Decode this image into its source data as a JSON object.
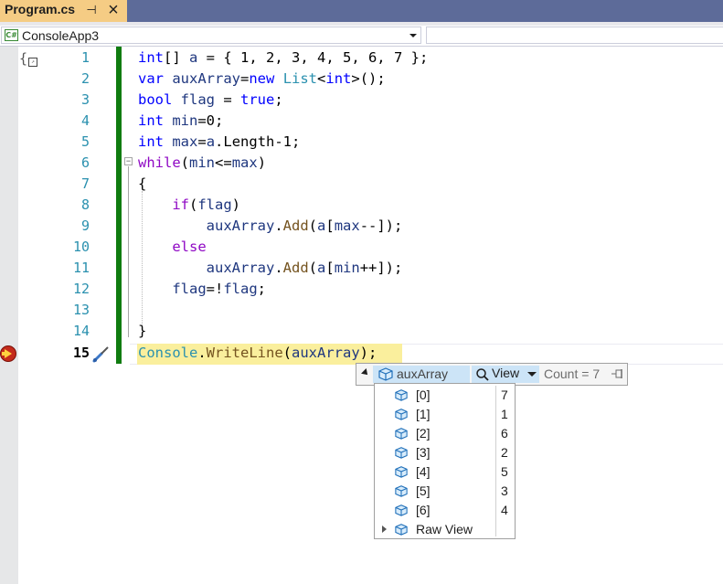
{
  "tab": {
    "title": "Program.cs",
    "pin_glyph": "⊣",
    "close_glyph": "×"
  },
  "navbar": {
    "project_icon": "C#",
    "project": "ConsoleApp3"
  },
  "editor": {
    "current_line": 15,
    "lines": [
      {
        "n": "1"
      },
      {
        "n": "2"
      },
      {
        "n": "3"
      },
      {
        "n": "4"
      },
      {
        "n": "5"
      },
      {
        "n": "6"
      },
      {
        "n": "7"
      },
      {
        "n": "8"
      },
      {
        "n": "9"
      },
      {
        "n": "10"
      },
      {
        "n": "11"
      },
      {
        "n": "12"
      },
      {
        "n": "13"
      },
      {
        "n": "14"
      },
      {
        "n": "15"
      }
    ],
    "code": {
      "l1": {
        "kw": "int",
        "rest1": "[] ",
        "var": "a",
        "rest2": " = { 1, 2, 3, 4, 5, 6, 7 };"
      },
      "l2": {
        "kw1": "var",
        "sp": " ",
        "var": "auxArray",
        "eq": "=",
        "kw2": "new",
        "sp2": " ",
        "ty": "List",
        "lt": "<",
        "kw3": "int",
        "gt": ">();"
      },
      "l3": {
        "kw": "bool",
        "sp": " ",
        "var": "flag",
        "eq": " = ",
        "kw2": "true",
        "end": ";"
      },
      "l4": {
        "kw": "int",
        "sp": " ",
        "var": "min",
        "rest": "=0;"
      },
      "l5": {
        "kw": "int",
        "sp": " ",
        "var": "max",
        "eq": "=",
        "var2": "a",
        "rest": ".Length-1;"
      },
      "l6": {
        "ctl": "while",
        "p1": "(",
        "v1": "min",
        "op": "<=",
        "v2": "max",
        "p2": ")"
      },
      "l7": {
        "text": "{"
      },
      "l8": {
        "ind": "    ",
        "ctl": "if",
        "p1": "(",
        "var": "flag",
        "p2": ")"
      },
      "l9": {
        "ind": "        ",
        "var": "auxArray",
        "dot": ".",
        "meth": "Add",
        "p1": "(",
        "v2": "a",
        "b1": "[",
        "v3": "max",
        "rest": "--]);"
      },
      "l10": {
        "ind": "    ",
        "ctl": "else"
      },
      "l11": {
        "ind": "        ",
        "var": "auxArray",
        "dot": ".",
        "meth": "Add",
        "p1": "(",
        "v2": "a",
        "b1": "[",
        "v3": "min",
        "rest": "++]);"
      },
      "l12": {
        "ind": "    ",
        "var": "flag",
        "eq": "=!",
        "var2": "flag",
        "end": ";"
      },
      "l13": {
        "text": ""
      },
      "l14": {
        "text": "}"
      },
      "l15": {
        "ty": "Console",
        "dot": ".",
        "meth": "WriteLine",
        "p1": "(",
        "var": "auxArray",
        "p2": ");"
      }
    }
  },
  "datatip": {
    "name": "auxArray",
    "view_label": "View",
    "count_label": "Count = 7",
    "items": [
      {
        "index": "[0]",
        "value": "7"
      },
      {
        "index": "[1]",
        "value": "1"
      },
      {
        "index": "[2]",
        "value": "6"
      },
      {
        "index": "[3]",
        "value": "2"
      },
      {
        "index": "[4]",
        "value": "5"
      },
      {
        "index": "[5]",
        "value": "3"
      },
      {
        "index": "[6]",
        "value": "4"
      }
    ],
    "raw_view_label": "Raw View"
  },
  "colors": {
    "tab_active": "#f5cc84",
    "tab_bar": "#5d6b99",
    "keyword": "#0000ff",
    "control_keyword": "#8f08c4",
    "type": "#2b91af",
    "variable": "#1f377f",
    "method": "#74531f",
    "line_number": "#2b91af",
    "change_bar": "#107c10",
    "statement_highlight": "#faef9d",
    "datatip_selection": "#cce4f7"
  },
  "icons": {
    "execution_pointer": "execution-arrow-icon",
    "edit_and_continue": "screwdriver-icon",
    "object": "object-cube-icon",
    "search": "magnifier-icon",
    "pin": "pin-icon"
  }
}
